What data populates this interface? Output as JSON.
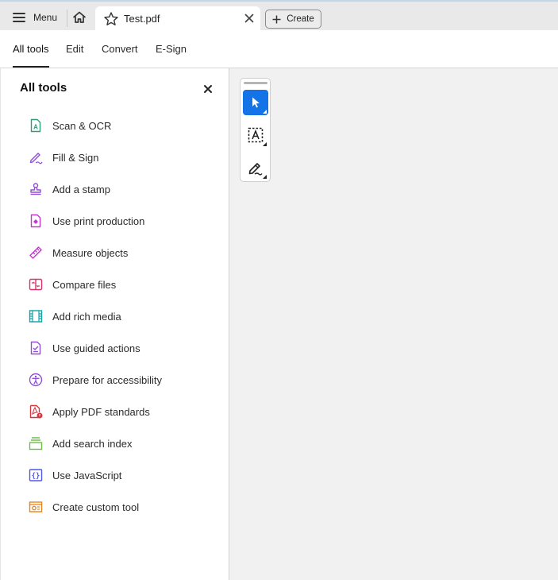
{
  "titlebar": {
    "menu_label": "Menu",
    "document_tab": "Test.pdf",
    "create_label": "Create"
  },
  "nav": {
    "tabs": [
      {
        "label": "All tools",
        "active": true
      },
      {
        "label": "Edit",
        "active": false
      },
      {
        "label": "Convert",
        "active": false
      },
      {
        "label": "E-Sign",
        "active": false
      }
    ]
  },
  "panel": {
    "title": "All tools",
    "tools": [
      {
        "label": "Scan & OCR",
        "icon": "scan-ocr-icon",
        "color": "#2d9d78"
      },
      {
        "label": "Fill & Sign",
        "icon": "fill-sign-icon",
        "color": "#8e4fd6"
      },
      {
        "label": "Add a stamp",
        "icon": "stamp-icon",
        "color": "#8e4fd6"
      },
      {
        "label": "Use print production",
        "icon": "print-production-icon",
        "color": "#c038cc"
      },
      {
        "label": "Measure objects",
        "icon": "ruler-icon",
        "color": "#c038cc"
      },
      {
        "label": "Compare files",
        "icon": "compare-files-icon",
        "color": "#d6336c"
      },
      {
        "label": "Add rich media",
        "icon": "film-icon",
        "color": "#12a3a8"
      },
      {
        "label": "Use guided actions",
        "icon": "guided-actions-icon",
        "color": "#8e4fd6"
      },
      {
        "label": "Prepare for accessibility",
        "icon": "accessibility-icon",
        "color": "#8e4fd6"
      },
      {
        "label": "Apply PDF standards",
        "icon": "pdf-standards-icon",
        "color": "#d7373f"
      },
      {
        "label": "Add search index",
        "icon": "search-index-icon",
        "color": "#6bc04b"
      },
      {
        "label": "Use JavaScript",
        "icon": "javascript-icon",
        "color": "#5258e4"
      },
      {
        "label": "Create custom tool",
        "icon": "custom-tool-icon",
        "color": "#e68619"
      }
    ]
  },
  "quick_tools": [
    {
      "name": "select-tool",
      "icon": "cursor-icon",
      "selected": true
    },
    {
      "name": "text-select-tool",
      "icon": "text-select-icon",
      "selected": false
    },
    {
      "name": "draw-tool",
      "icon": "pen-icon",
      "selected": false
    }
  ],
  "colors": {
    "accent": "#1473e6",
    "titlebar_bg": "#e9e9e9",
    "work_bg": "#f1f1f1"
  }
}
